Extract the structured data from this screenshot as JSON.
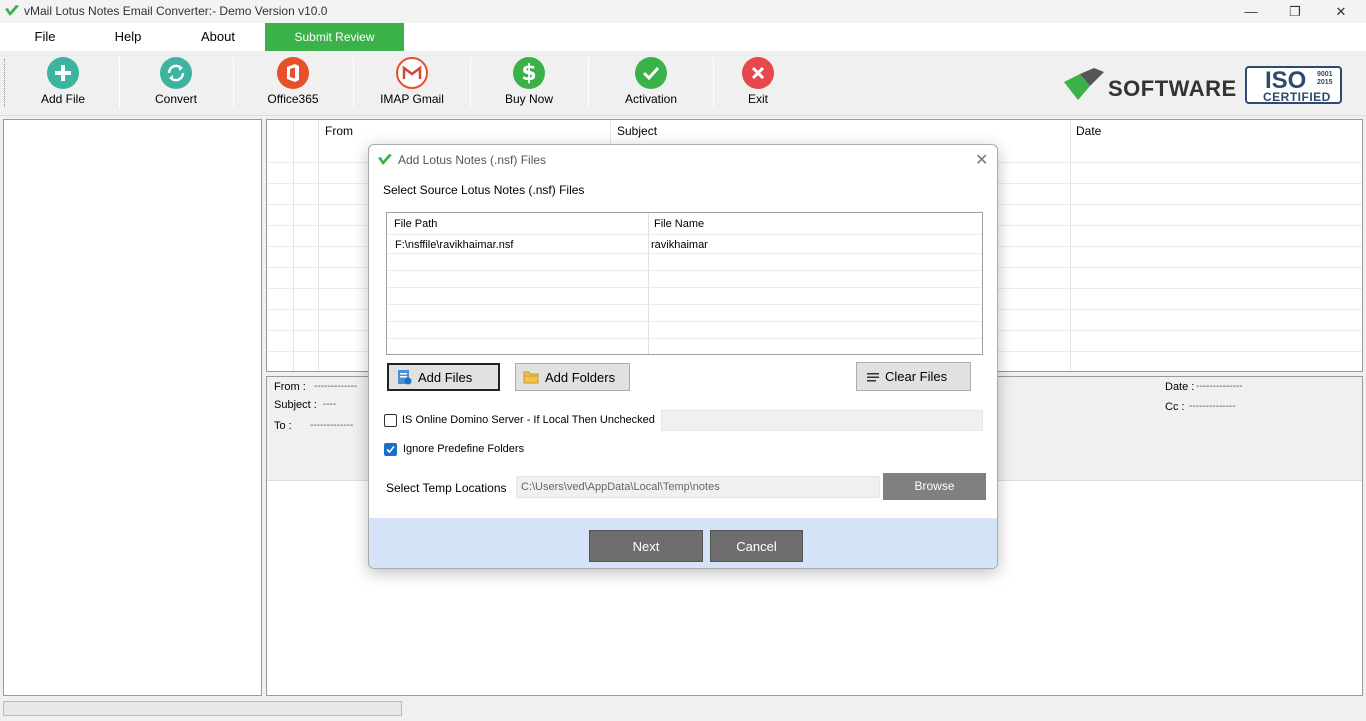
{
  "window": {
    "title": "vMail Lotus Notes Email Converter:- Demo Version v10.0",
    "controls": {
      "minimize": "—",
      "restore": "❐",
      "close": "✕"
    }
  },
  "menu": {
    "file": "File",
    "help": "Help",
    "about": "About",
    "submit_review": "Submit Review"
  },
  "toolbar": {
    "add_file": "Add File",
    "convert": "Convert",
    "office365": "Office365",
    "imap_gmail": "IMAP Gmail",
    "buy_now": "Buy Now",
    "activation": "Activation",
    "exit": "Exit"
  },
  "branding": {
    "software": "SOFTWARE",
    "iso": "ISO",
    "iso_numbers": [
      "9001",
      "2015"
    ],
    "certified": "CERTIFIED"
  },
  "email_grid": {
    "columns": [
      "From",
      "Subject",
      "Date"
    ]
  },
  "preview": {
    "from_label": "From :",
    "from_value": "-------------",
    "subject_label": "Subject :",
    "subject_value": "----",
    "to_label": "To :",
    "to_value": "-------------",
    "date_label": "Date :",
    "date_value": "--------------",
    "cc_label": "Cc :",
    "cc_value": "--------------"
  },
  "dialog": {
    "title": "Add Lotus Notes (.nsf) Files",
    "close": "✕",
    "heading": "Select Source Lotus Notes (.nsf) Files",
    "file_list": {
      "columns": [
        "File Path",
        "File Name"
      ],
      "rows": [
        {
          "path": "F:\\nsffile\\ravikhaimar.nsf",
          "name": "ravikhaimar"
        }
      ]
    },
    "add_files": "Add Files",
    "add_folders": "Add Folders",
    "clear_files": "Clear Files",
    "domino_checkbox": {
      "label": "IS Online Domino Server - If Local Then Unchecked",
      "checked": false
    },
    "ignore_checkbox": {
      "label": "Ignore Predefine Folders",
      "checked": true
    },
    "temp_label": "Select Temp Locations",
    "temp_value": "C:\\Users\\ved\\AppData\\Local\\Temp\\notes",
    "browse": "Browse",
    "next": "Next",
    "cancel": "Cancel"
  },
  "colors": {
    "accent_green": "#3bb14a",
    "add_icon": "#3cb4a0",
    "office_red": "#e4512a",
    "exit_red": "#e5484d",
    "footer_blue": "#d4e3f7",
    "iso_blue": "#2e4a6e"
  }
}
